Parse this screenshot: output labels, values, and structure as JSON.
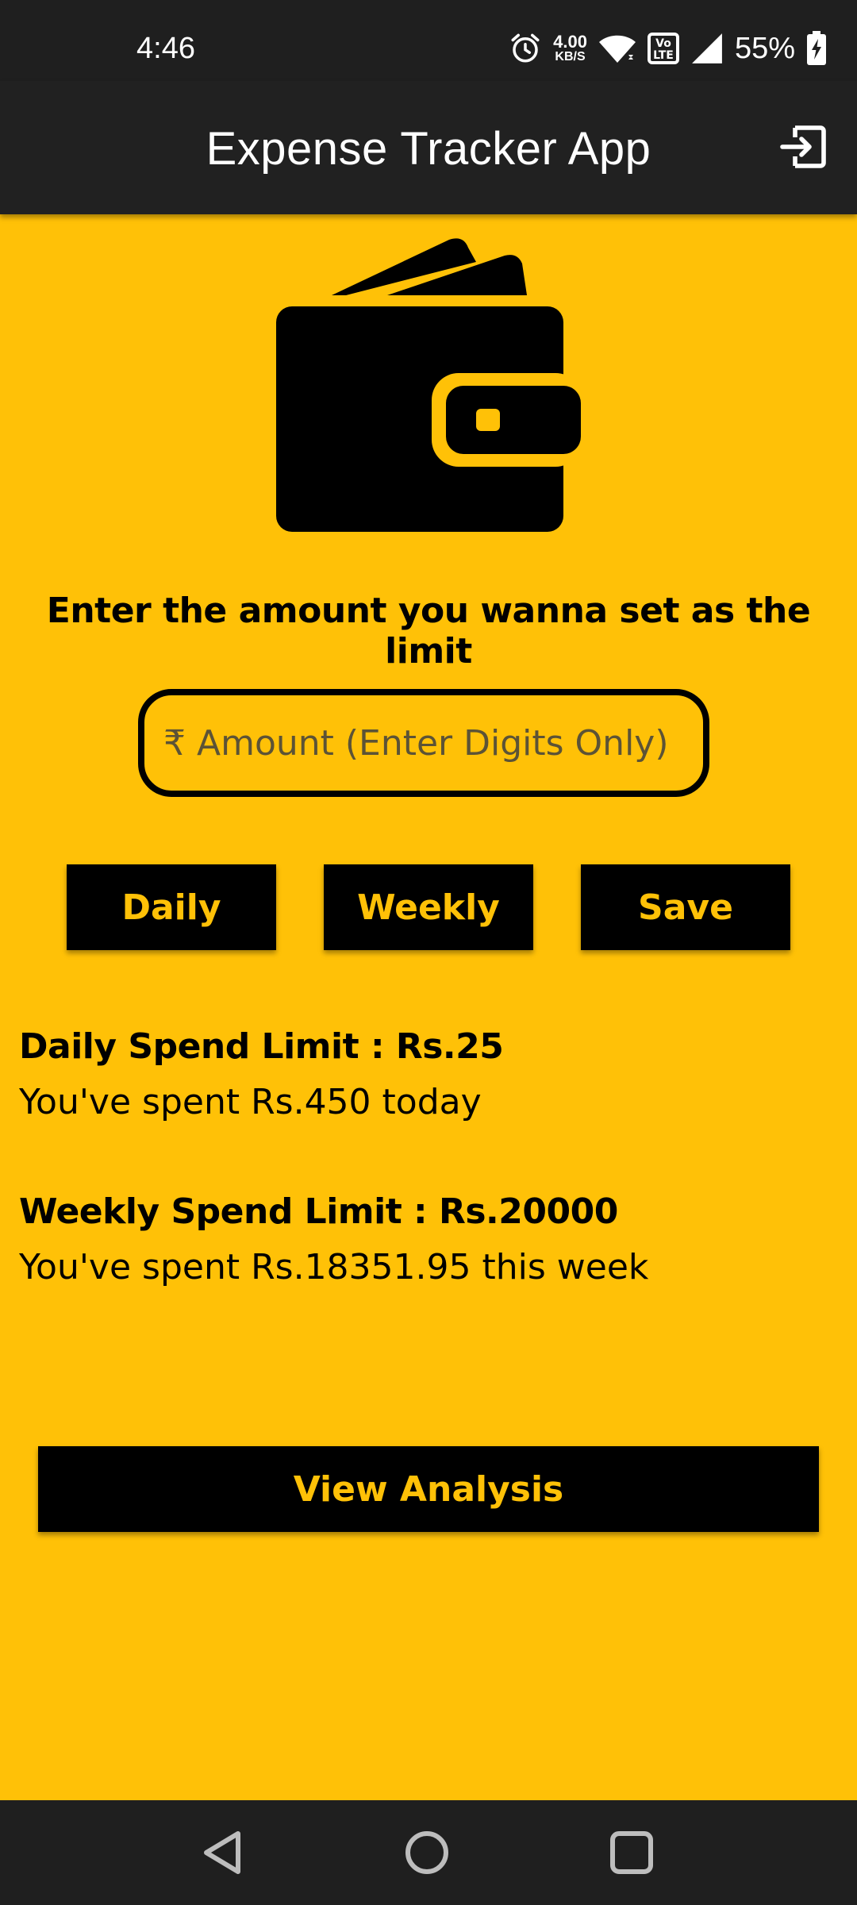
{
  "status_bar": {
    "time": "4:46",
    "net_speed_value": "4.00",
    "net_speed_unit": "KB/S",
    "battery_percent": "55%"
  },
  "app_bar": {
    "title": "Expense Tracker App"
  },
  "prompt": "Enter the amount you wanna set as the limit",
  "amount_input": {
    "placeholder": "₹ Amount (Enter Digits Only)",
    "value": ""
  },
  "buttons": {
    "daily": "Daily",
    "weekly": "Weekly",
    "save": "Save"
  },
  "daily": {
    "limit_label": "Daily Spend Limit : Rs.25",
    "spent_text": "You've spent Rs.450 today"
  },
  "weekly": {
    "limit_label": "Weekly Spend Limit : Rs.20000",
    "spent_text": "You've spent Rs.18351.95 this week"
  },
  "view_analysis": "View Analysis",
  "icons": {
    "alarm": "alarm-icon",
    "wifi": "wifi-icon",
    "volte": "volte-icon",
    "signal": "signal-icon",
    "battery": "battery-charging-icon",
    "logout": "logout-icon",
    "wallet": "wallet-icon",
    "back": "back-icon",
    "home": "home-icon",
    "recents": "recents-icon"
  },
  "colors": {
    "background": "#FFC107",
    "bar": "#1F1F1F",
    "button": "#000000",
    "button_text": "#FFC107"
  }
}
